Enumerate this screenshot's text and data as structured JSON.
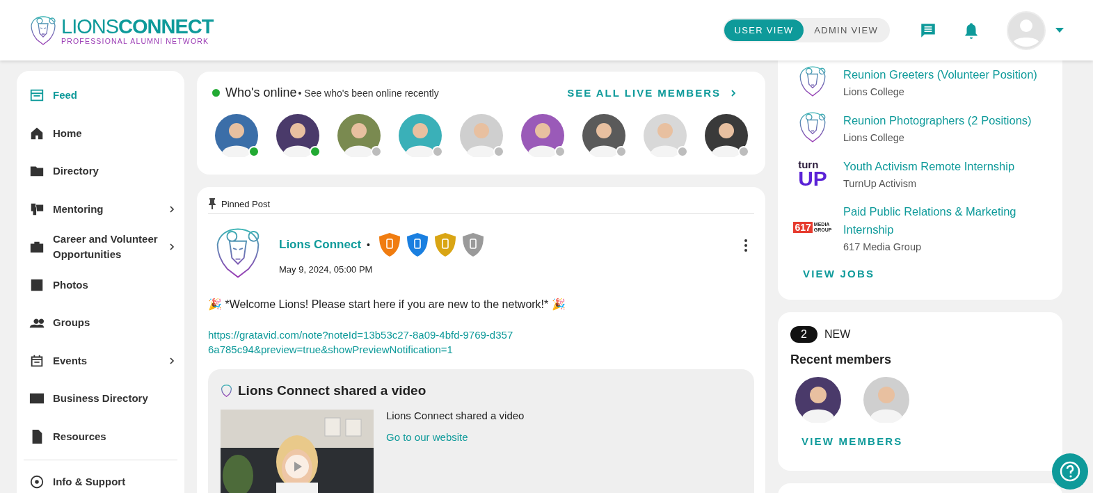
{
  "header": {
    "logo": {
      "word_1": "LIONS",
      "word_2": "CONNECT",
      "tagline": "PROFESSIONAL ALUMNI NETWORK"
    },
    "view_toggle": [
      {
        "label": "USER VIEW",
        "selected": true
      },
      {
        "label": "ADMIN VIEW",
        "selected": false
      }
    ]
  },
  "sidebar": {
    "items": [
      {
        "label": "Feed",
        "selected": true,
        "has_submenu": false
      },
      {
        "label": "Home",
        "selected": false,
        "has_submenu": false
      },
      {
        "label": "Directory",
        "selected": false,
        "has_submenu": false
      },
      {
        "label": "Mentoring",
        "selected": false,
        "has_submenu": true
      },
      {
        "label": "Career and Volunteer Opportunities",
        "selected": false,
        "has_submenu": true
      },
      {
        "label": "Photos",
        "selected": false,
        "has_submenu": false
      },
      {
        "label": "Groups",
        "selected": false,
        "has_submenu": false
      },
      {
        "label": "Events",
        "selected": false,
        "has_submenu": true
      },
      {
        "label": "Business Directory",
        "selected": false,
        "has_submenu": false
      },
      {
        "label": "Resources",
        "selected": false,
        "has_submenu": false
      }
    ],
    "footer_item": {
      "label": "Info & Support"
    }
  },
  "whos_online": {
    "title": "Who's online",
    "subtitle": " • See who's been online recently",
    "link": "SEE ALL LIVE MEMBERS",
    "members": [
      {
        "online": true
      },
      {
        "online": true
      },
      {
        "online": false
      },
      {
        "online": false
      },
      {
        "online": false
      },
      {
        "online": false
      },
      {
        "online": false
      },
      {
        "online": false
      },
      {
        "online": false
      }
    ]
  },
  "post": {
    "pinned_label": "Pinned Post",
    "author": "Lions Connect",
    "separator": "•",
    "badges": [
      {
        "color": "#f07c10"
      },
      {
        "color": "#1a7fe0"
      },
      {
        "color": "#d9a514"
      },
      {
        "color": "#9a9a9a"
      }
    ],
    "date": "May 9, 2024, 05:00 PM",
    "text": "🎉 *Welcome Lions!  Please start here if you are new to the network!* 🎉",
    "link": "https://gratavid.com/note?noteId=13b53c27-8a09-4bfd-9769-d3576a785c94&preview=true&showPreviewNotification=1",
    "shared": {
      "title": "Lions Connect shared a video",
      "description": "Lions Connect shared a video",
      "link": "Go to our website"
    }
  },
  "jobs": {
    "items": [
      {
        "kind": "lion",
        "title": "Reunion Greeters (Volunteer Position)",
        "company": "Lions College"
      },
      {
        "kind": "lion",
        "title": "Reunion Photographers (2 Positions)",
        "company": "Lions College"
      },
      {
        "kind": "turnup",
        "logo_text": [
          "turn",
          "UP"
        ],
        "title": "Youth Activism Remote Internship",
        "company": "TurnUp Activism"
      },
      {
        "kind": "media",
        "logo_text": [
          "617",
          "MEDIA",
          "GROUP"
        ],
        "title": "Paid Public Relations & Marketing Internship",
        "company": "617 Media Group"
      }
    ],
    "button": "VIEW JOBS"
  },
  "new_members": {
    "count": "2",
    "count_label": "NEW",
    "title": "Recent members",
    "button": "VIEW MEMBERS"
  }
}
